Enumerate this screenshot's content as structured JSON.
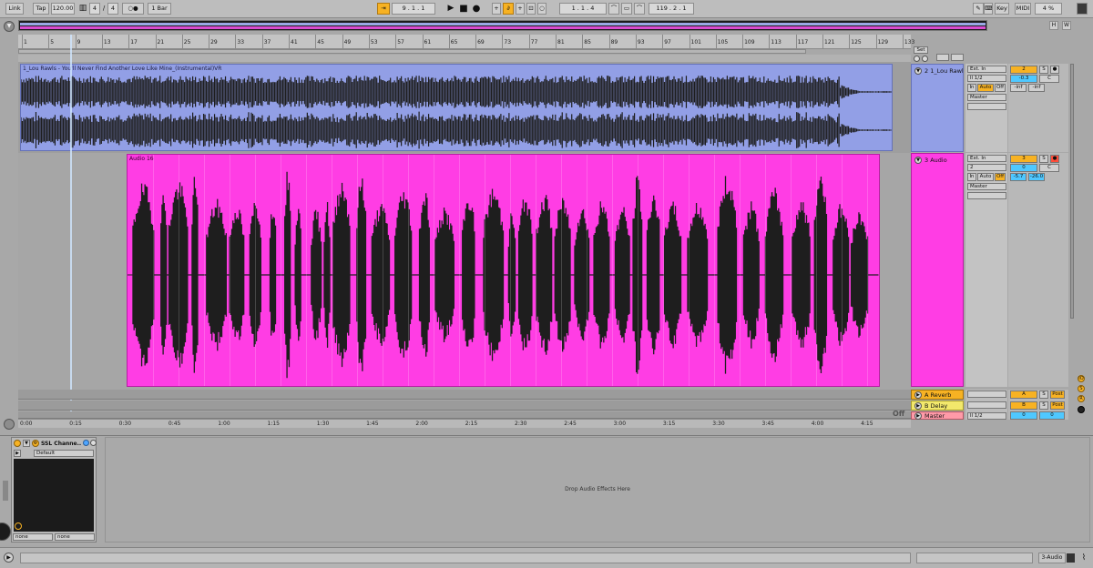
{
  "toolbar": {
    "link": "Link",
    "tap": "Tap",
    "tempo": "120.00",
    "signature_num": "4",
    "signature_sep": "/",
    "signature_den": "4",
    "metronome": "○●",
    "quantize": "1 Bar",
    "position": "9 .  1 .  1",
    "loop_start": "1 .  1 .  4",
    "loop_length": "119 .  2 .  1",
    "key": "Key",
    "midi": "MIDI",
    "cpu": "4 %",
    "hw_h": "H",
    "hw_w": "W"
  },
  "ruler": {
    "bars": [
      "1",
      "5",
      "9",
      "13",
      "17",
      "21",
      "25",
      "29",
      "33",
      "37",
      "41",
      "45",
      "49",
      "53",
      "57",
      "61",
      "65",
      "69",
      "73",
      "77",
      "81",
      "85",
      "89",
      "93",
      "97",
      "101",
      "105",
      "109",
      "113",
      "117",
      "121",
      "125",
      "129",
      "133"
    ],
    "set_label": "Set"
  },
  "tracks": [
    {
      "name": "2 1_Lou Rawl",
      "clip_title": "1_Lou Rawls - You'll Never Find Another Love Like Mine_(Instrumental)VR",
      "input_type": "Ext. In",
      "input_channel": "ll 1/2",
      "monitor_in": "In",
      "monitor_auto": "Auto",
      "monitor_off": "Off",
      "output": "Master",
      "number": "2",
      "solo": "S",
      "volume": "-0.3",
      "pan": "C",
      "peak_l": "-inf",
      "peak_r": "-inf"
    },
    {
      "name": "3 Audio",
      "clip_title": "Audio 16",
      "input_type": "Ext. In",
      "input_channel": "2",
      "monitor_in": "In",
      "monitor_auto": "Auto",
      "monitor_off": "Off",
      "output": "Master",
      "number": "3",
      "solo": "S",
      "volume": "0",
      "pan": "C",
      "peak_l": "-5.7",
      "peak_r": "-26.0"
    }
  ],
  "returns": [
    {
      "name": "A Reverb",
      "letter": "A",
      "solo": "S",
      "post": "Post",
      "color": "#f7b223"
    },
    {
      "name": "B Delay",
      "letter": "B",
      "solo": "S",
      "post": "Post",
      "color": "#f2e86b"
    }
  ],
  "master": {
    "name": "Master",
    "channel": "ll 1/2",
    "vol_l": "0",
    "vol_r": "0",
    "color": "#ff9aa8"
  },
  "timeline": {
    "marks": [
      "0:00",
      "0:15",
      "0:30",
      "0:45",
      "1:00",
      "1:15",
      "1:30",
      "1:45",
      "2:00",
      "2:15",
      "2:30",
      "2:45",
      "3:00",
      "3:15",
      "3:30",
      "3:45",
      "4:00",
      "4:15"
    ],
    "off_label": "Off"
  },
  "device": {
    "name": "SSL Channe...",
    "preset": "Default",
    "sel_a": "none",
    "sel_b": "none",
    "drop_hint": "Drop Audio Effects Here"
  },
  "status": {
    "track_label": "3-Audio"
  },
  "colors": {
    "track1": "#929fe6",
    "track2": "#ff3de4",
    "accent": "#f7b223"
  }
}
